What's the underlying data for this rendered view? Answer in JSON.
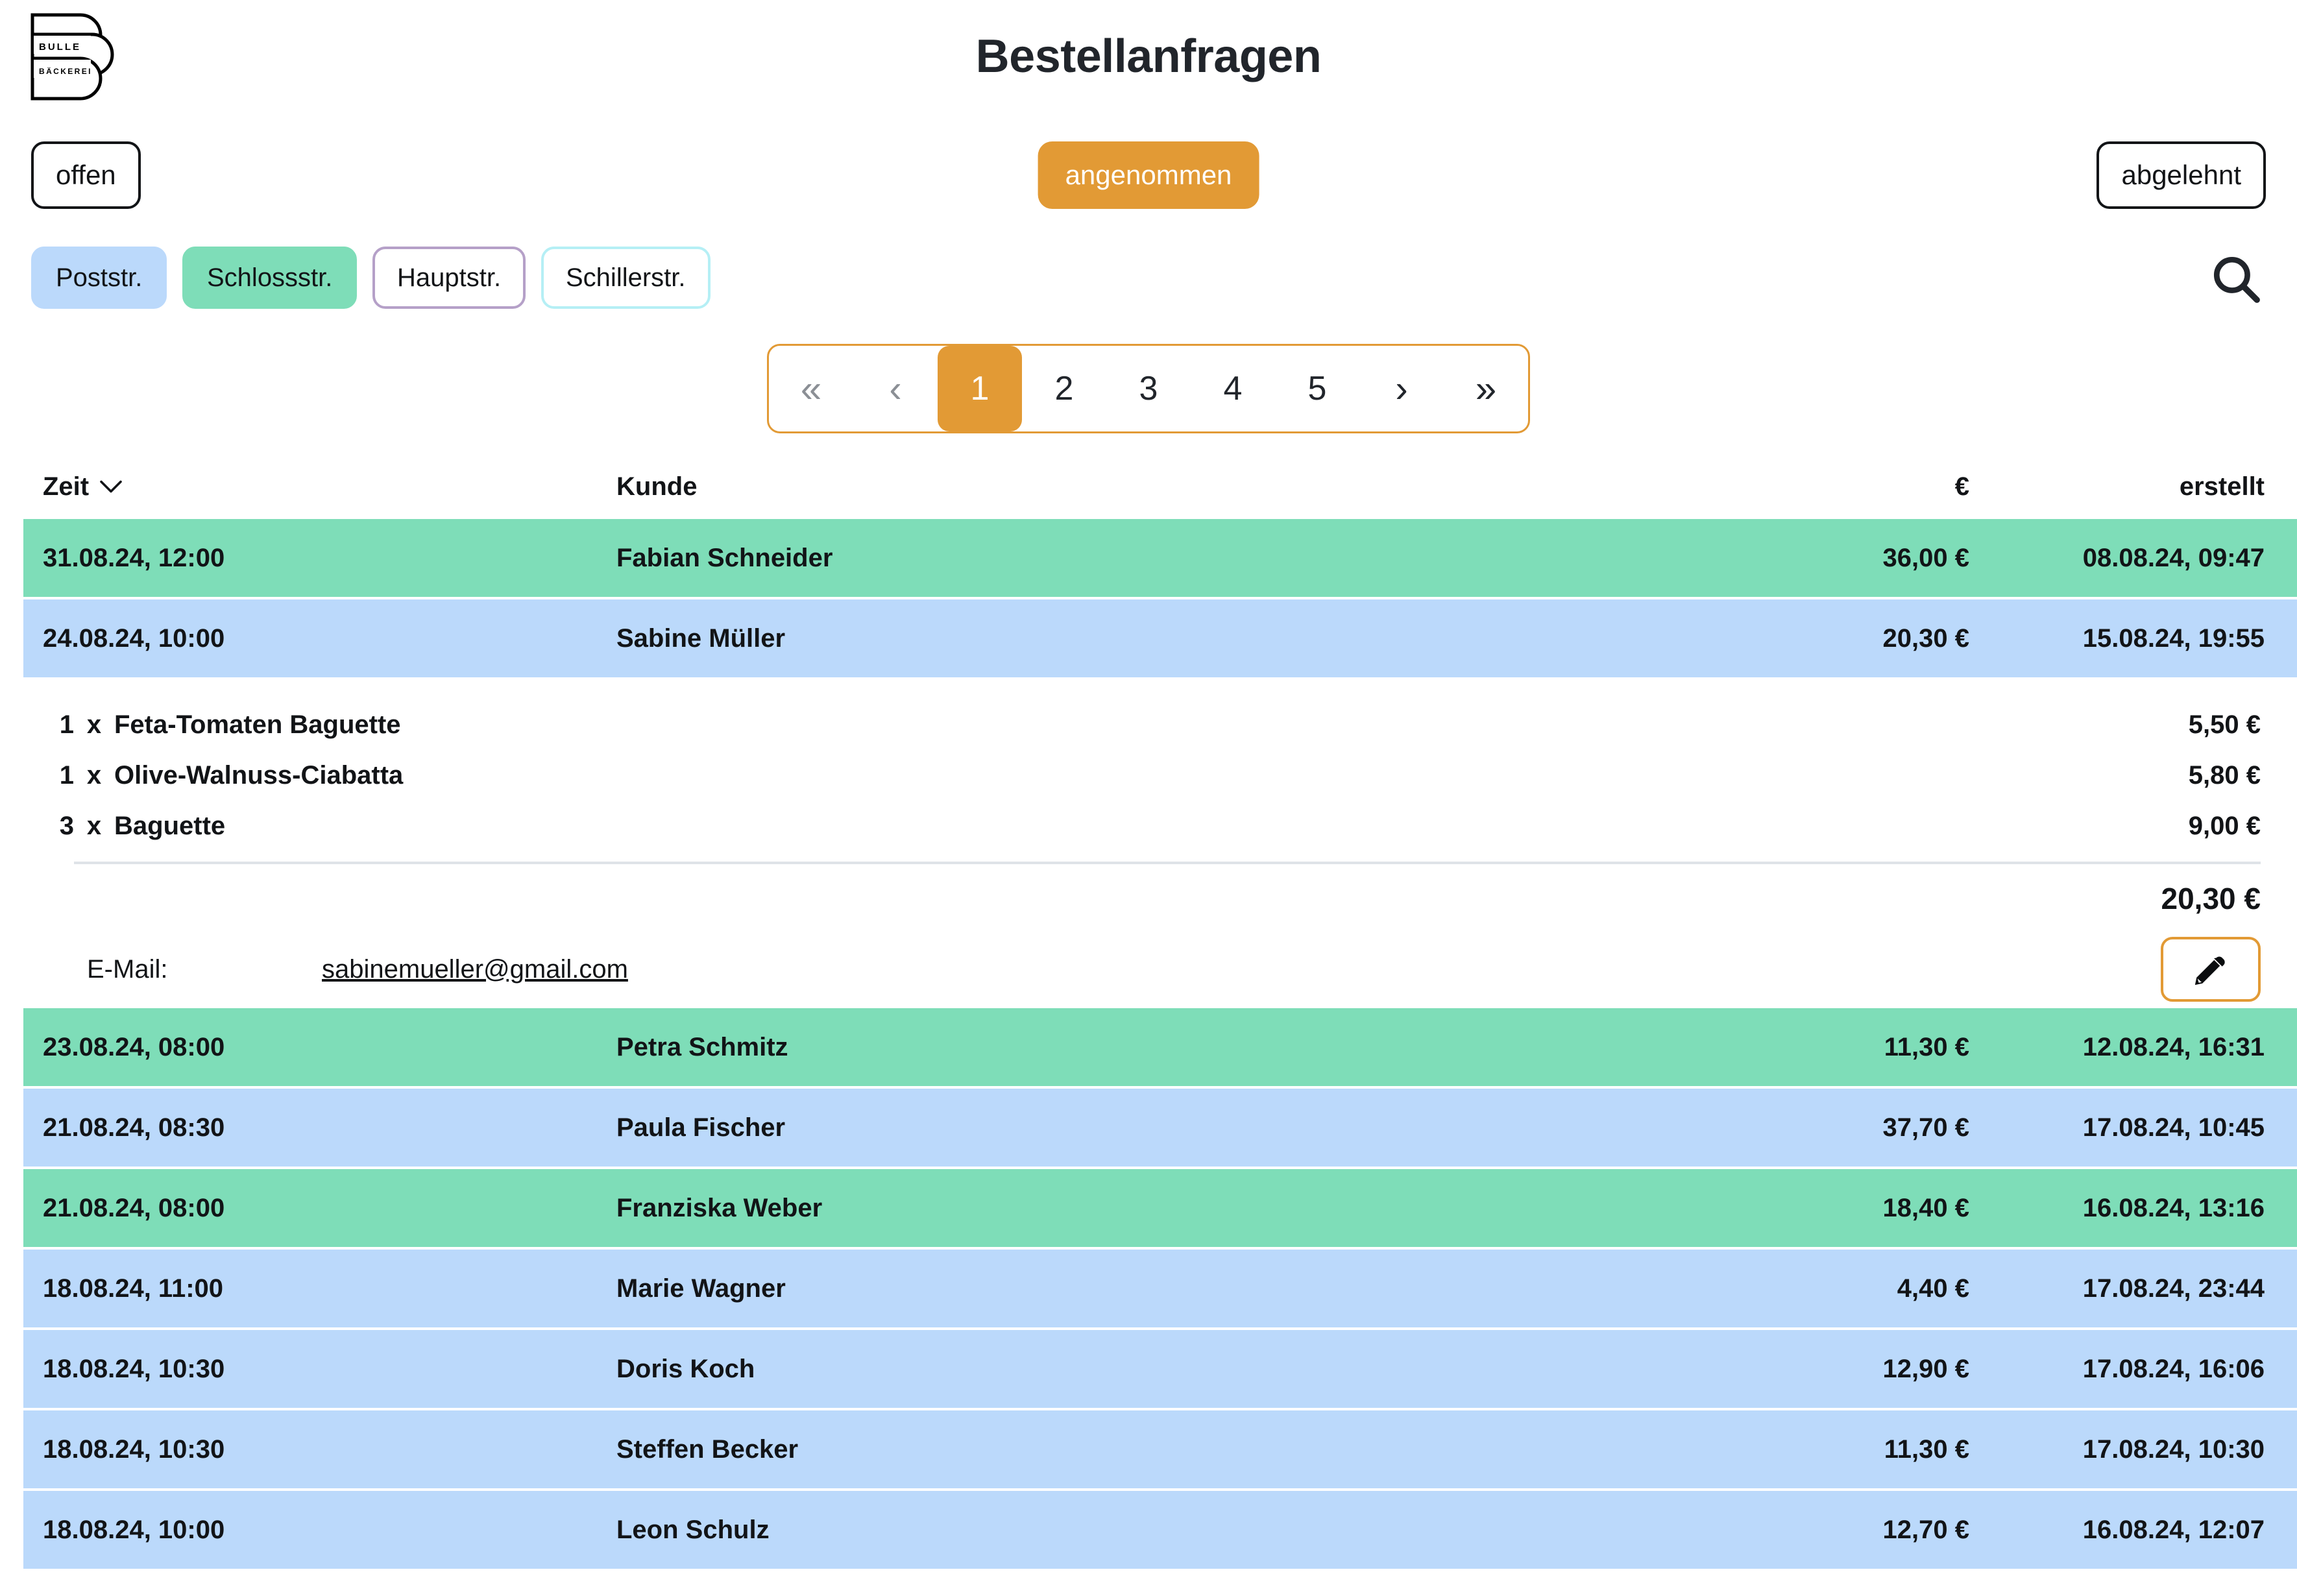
{
  "brand": {
    "logo_line1": "BULLE",
    "logo_line2": "BÄCKEREI",
    "accent_orange": "#e29a35",
    "row_green": "#7eddb8",
    "row_blue": "#bbd9fb"
  },
  "header": {
    "title": "Bestellanfragen"
  },
  "status_filter": {
    "open_label": "offen",
    "accepted_label": "angenommen",
    "rejected_label": "abgelehnt",
    "selected": "angenommen"
  },
  "location_filter": {
    "chips": [
      {
        "label": "Poststr.",
        "style": "filled",
        "color": "#bbd9fb"
      },
      {
        "label": "Schlossstr.",
        "style": "filled",
        "color": "#7eddb8"
      },
      {
        "label": "Hauptstr.",
        "style": "outline",
        "color": "#b5a0c8"
      },
      {
        "label": "Schillerstr.",
        "style": "outline",
        "color": "#b5eff5"
      }
    ]
  },
  "search": {
    "icon": "search-icon"
  },
  "pagination": {
    "first_label": "«",
    "prev_label": "‹",
    "next_label": "›",
    "last_label": "»",
    "pages": [
      "1",
      "2",
      "3",
      "4",
      "5"
    ],
    "current": "1"
  },
  "table": {
    "headers": {
      "zeit": "Zeit",
      "kunde": "Kunde",
      "euro": "€",
      "erstellt": "erstellt"
    },
    "sort_icon": "chevron-down-icon",
    "rows": [
      {
        "zeit": "31.08.24, 12:00",
        "kunde": "Fabian Schneider",
        "betrag": "36,00 €",
        "erstellt": "08.08.24, 09:47",
        "color": "green",
        "expanded": false
      },
      {
        "zeit": "24.08.24, 10:00",
        "kunde": "Sabine Müller",
        "betrag": "20,30 €",
        "erstellt": "15.08.24, 19:55",
        "color": "blue",
        "expanded": true
      },
      {
        "zeit": "23.08.24, 08:00",
        "kunde": "Petra Schmitz",
        "betrag": "11,30 €",
        "erstellt": "12.08.24, 16:31",
        "color": "green",
        "expanded": false
      },
      {
        "zeit": "21.08.24, 08:30",
        "kunde": "Paula Fischer",
        "betrag": "37,70 €",
        "erstellt": "17.08.24, 10:45",
        "color": "blue",
        "expanded": false
      },
      {
        "zeit": "21.08.24, 08:00",
        "kunde": "Franziska Weber",
        "betrag": "18,40 €",
        "erstellt": "16.08.24, 13:16",
        "color": "green",
        "expanded": false
      },
      {
        "zeit": "18.08.24, 11:00",
        "kunde": "Marie Wagner",
        "betrag": "4,40 €",
        "erstellt": "17.08.24, 23:44",
        "color": "blue",
        "expanded": false
      },
      {
        "zeit": "18.08.24, 10:30",
        "kunde": "Doris Koch",
        "betrag": "12,90 €",
        "erstellt": "17.08.24, 16:06",
        "color": "blue",
        "expanded": false
      },
      {
        "zeit": "18.08.24, 10:30",
        "kunde": "Steffen Becker",
        "betrag": "11,30 €",
        "erstellt": "17.08.24, 10:30",
        "color": "blue",
        "expanded": false
      },
      {
        "zeit": "18.08.24, 10:00",
        "kunde": "Leon Schulz",
        "betrag": "12,70 €",
        "erstellt": "16.08.24, 12:07",
        "color": "blue",
        "expanded": false
      }
    ]
  },
  "order_detail": {
    "items": [
      {
        "qty": "1",
        "sep": "x",
        "name": "Feta-Tomaten Baguette",
        "price": "5,50 €"
      },
      {
        "qty": "1",
        "sep": "x",
        "name": "Olive-Walnuss-Ciabatta",
        "price": "5,80 €"
      },
      {
        "qty": "3",
        "sep": "x",
        "name": "Baguette",
        "price": "9,00 €"
      }
    ],
    "total": "20,30 €",
    "email_label": "E-Mail:",
    "email_value": "sabinemueller@gmail.com",
    "edit_icon": "pencil-icon"
  }
}
